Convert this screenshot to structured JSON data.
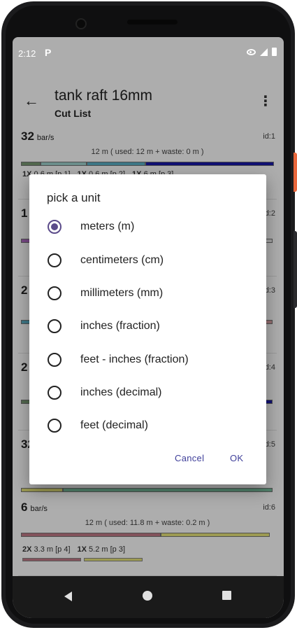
{
  "status_bar": {
    "time": "2:12",
    "notification": "P"
  },
  "app_bar": {
    "title": "tank raft 16mm",
    "subtitle": "Cut List",
    "back_icon": "arrow-left-icon",
    "menu_icon": "more-vert-icon"
  },
  "cards": [
    {
      "count": "32",
      "unit": "bar/s",
      "id": "id:1",
      "summary": "12 m ( used: 12 m + waste: 0 m )",
      "pieces": [
        {
          "qty": "1X",
          "text": "0.6 m [p 1]"
        },
        {
          "qty": "1X",
          "text": "0.6 m [p 2]"
        },
        {
          "qty": "1X",
          "text": "6 m [p 3]"
        }
      ],
      "bar_colors": [
        "#7a9a74",
        "#9fd3cf",
        "#5ab0c7",
        "#1a1aa8"
      ]
    },
    {
      "count": "1",
      "unit": "",
      "id": "id:2",
      "bar_colors": [
        "#b06ac4",
        "#9fd3cf"
      ]
    },
    {
      "count": "2",
      "unit": "",
      "id": "id:3",
      "bar_colors": [
        "#5ab0c7",
        "#d9a2a5"
      ]
    },
    {
      "count": "2",
      "unit": "",
      "id": "id:4",
      "bar_colors": [
        "#7a9a74",
        "#1a1aa8"
      ]
    },
    {
      "count": "32",
      "unit": "",
      "id": "id:5",
      "bar_colors": [
        "#e6e47a",
        "#7ac0a0"
      ]
    },
    {
      "count": "6",
      "unit": "bar/s",
      "id": "id:6",
      "summary": "12 m ( used: 11.8 m + waste: 0.2 m )",
      "pieces": [
        {
          "qty": "2X",
          "text": "3.3 m [p 4]"
        },
        {
          "qty": "1X",
          "text": "5.2 m [p 3]"
        }
      ],
      "bar_colors": [
        "#c27a86",
        "#e6e47a"
      ]
    }
  ],
  "dialog": {
    "title": "pick a unit",
    "options": [
      {
        "label": "meters (m)",
        "selected": true
      },
      {
        "label": "centimeters (cm)",
        "selected": false
      },
      {
        "label": "millimeters (mm)",
        "selected": false
      },
      {
        "label": "inches (fraction)",
        "selected": false
      },
      {
        "label": "feet - inches (fraction)",
        "selected": false
      },
      {
        "label": "inches (decimal)",
        "selected": false
      },
      {
        "label": "feet (decimal)",
        "selected": false
      }
    ],
    "cancel_label": "Cancel",
    "ok_label": "OK"
  },
  "nav_bar": {
    "back_icon": "nav-back-icon",
    "home_icon": "nav-home-icon",
    "recents_icon": "nav-recents-icon"
  }
}
